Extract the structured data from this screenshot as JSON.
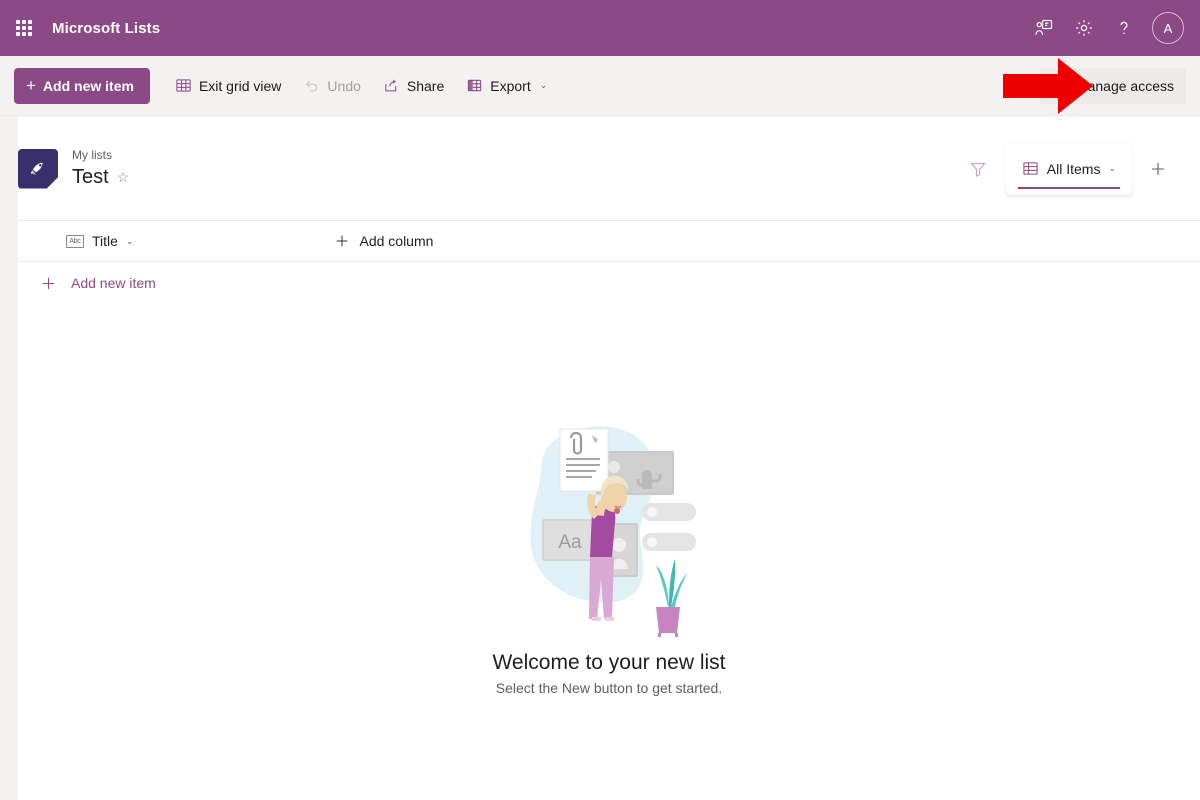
{
  "suite_header": {
    "waffle_label": "App launcher",
    "title": "Microsoft Lists",
    "actions": [
      {
        "name": "meet-now-icon",
        "label": "Meet now"
      },
      {
        "name": "settings-icon",
        "label": "Settings"
      },
      {
        "name": "help-icon",
        "label": "Help"
      }
    ],
    "avatar_initial": "A",
    "background": "#8b4a86"
  },
  "command_bar": {
    "add_new_item": "Add new item",
    "exit_grid_view": "Exit grid view",
    "undo": "Undo",
    "share": "Share",
    "export": "Export",
    "export_chevron": "⌄",
    "manage_access": "Manage access"
  },
  "annotation": {
    "arrow_color": "#ee0000",
    "points_to": "Manage access"
  },
  "list_header": {
    "breadcrumb": "My lists",
    "title": "Test",
    "favorite_icon": "☆",
    "icon_tile_color": "#37306b",
    "filter_label": "Filter",
    "view_name": "All Items",
    "view_chevron": "⌄",
    "add_view_label": "Add view",
    "accent_color": "#8b4a86"
  },
  "grid": {
    "columns": [
      {
        "name": "title",
        "label": "Title",
        "type_icon": "Abc",
        "chevron": "⌄"
      }
    ],
    "add_column_label": "Add column",
    "add_new_item_label": "Add new item",
    "rows": []
  },
  "empty_state": {
    "title": "Welcome to your new list",
    "subtitle": "Select the New button to get started.",
    "illustration": "person-holding-document",
    "illustration_text": "Aa"
  }
}
